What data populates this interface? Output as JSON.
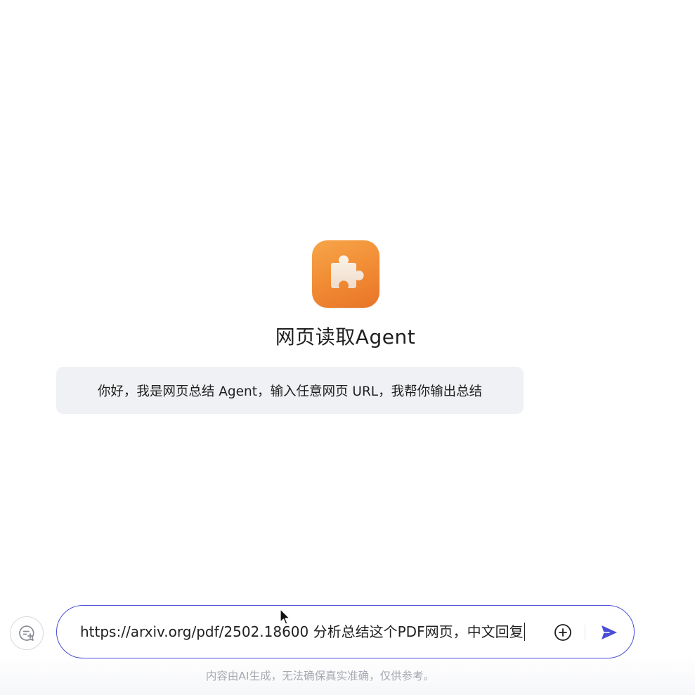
{
  "agent": {
    "icon": "puzzle-piece-icon",
    "icon_color": "#f08a32",
    "title": "网页读取Agent"
  },
  "greeting": {
    "message": "你好，我是网页总结 Agent，输入任意网页 URL，我帮你输出总结"
  },
  "composer": {
    "value": "https://arxiv.org/pdf/2502.18600 分析总结这个PDF网页，中文回复",
    "border_color": "#4a4ed6",
    "attach_icon": "plus-circle-icon",
    "send_icon": "send-icon",
    "send_color": "#4a4ed6"
  },
  "new_chat": {
    "icon": "new-chat-icon"
  },
  "footer": {
    "disclaimer": "内容由AI生成，无法确保真实准确，仅供参考。"
  }
}
